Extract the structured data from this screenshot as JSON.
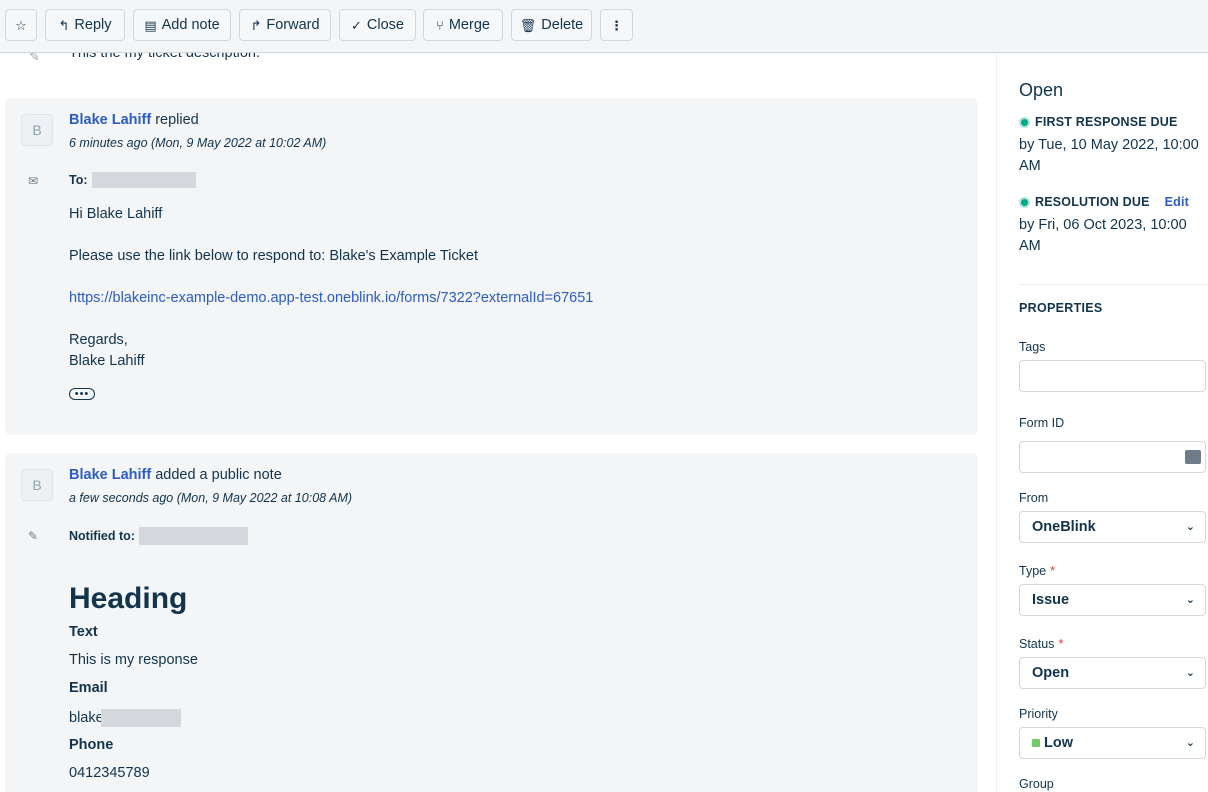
{
  "toolbar": {
    "reply": "Reply",
    "add_note": "Add note",
    "forward": "Forward",
    "close": "Close",
    "merge": "Merge",
    "delete": "Delete"
  },
  "description": "This the my ticket description.",
  "conversations": [
    {
      "avatar": "B",
      "author": "Blake Lahiff",
      "action": "replied",
      "meta": "6 minutes ago (Mon, 9 May 2022 at 10:02 AM)",
      "to_label": "To:",
      "lines": [
        "Hi Blake Lahiff",
        "Please use the link below to respond to: Blake's Example Ticket",
        "https://blakeinc-example-demo.app-test.oneblink.io/forms/7322?externalId=67651",
        "Regards,",
        "Blake Lahiff"
      ]
    },
    {
      "avatar": "B",
      "author": "Blake Lahiff",
      "action": "added a public note",
      "meta": "a few seconds ago (Mon, 9 May 2022 at 10:08 AM)",
      "to_label": "Notified to:",
      "heading": "Heading",
      "fields": [
        {
          "label": "Text",
          "value": "This is my response"
        },
        {
          "label": "Email",
          "value": "blake"
        },
        {
          "label": "Phone",
          "value": "0412345789"
        }
      ]
    }
  ],
  "sidebar": {
    "status": "Open",
    "first_response": {
      "title": "FIRST RESPONSE DUE",
      "by": "by Tue, 10 May 2022, 10:00 AM"
    },
    "resolution": {
      "title": "RESOLUTION DUE",
      "edit": "Edit",
      "by": "by Fri, 06 Oct 2023, 10:00 AM"
    },
    "properties_title": "PROPERTIES",
    "tags_label": "Tags",
    "form_id_label": "Form ID",
    "from_label": "From",
    "from_value": "OneBlink",
    "type_label": "Type",
    "type_value": "Issue",
    "status_label": "Status",
    "status_value": "Open",
    "priority_label": "Priority",
    "priority_value": "Low",
    "group_label": "Group"
  },
  "colors": {
    "link": "#2c5cc5",
    "sla_dot": "#00a886",
    "required": "#e43538",
    "priority_low": "#70cc67"
  }
}
